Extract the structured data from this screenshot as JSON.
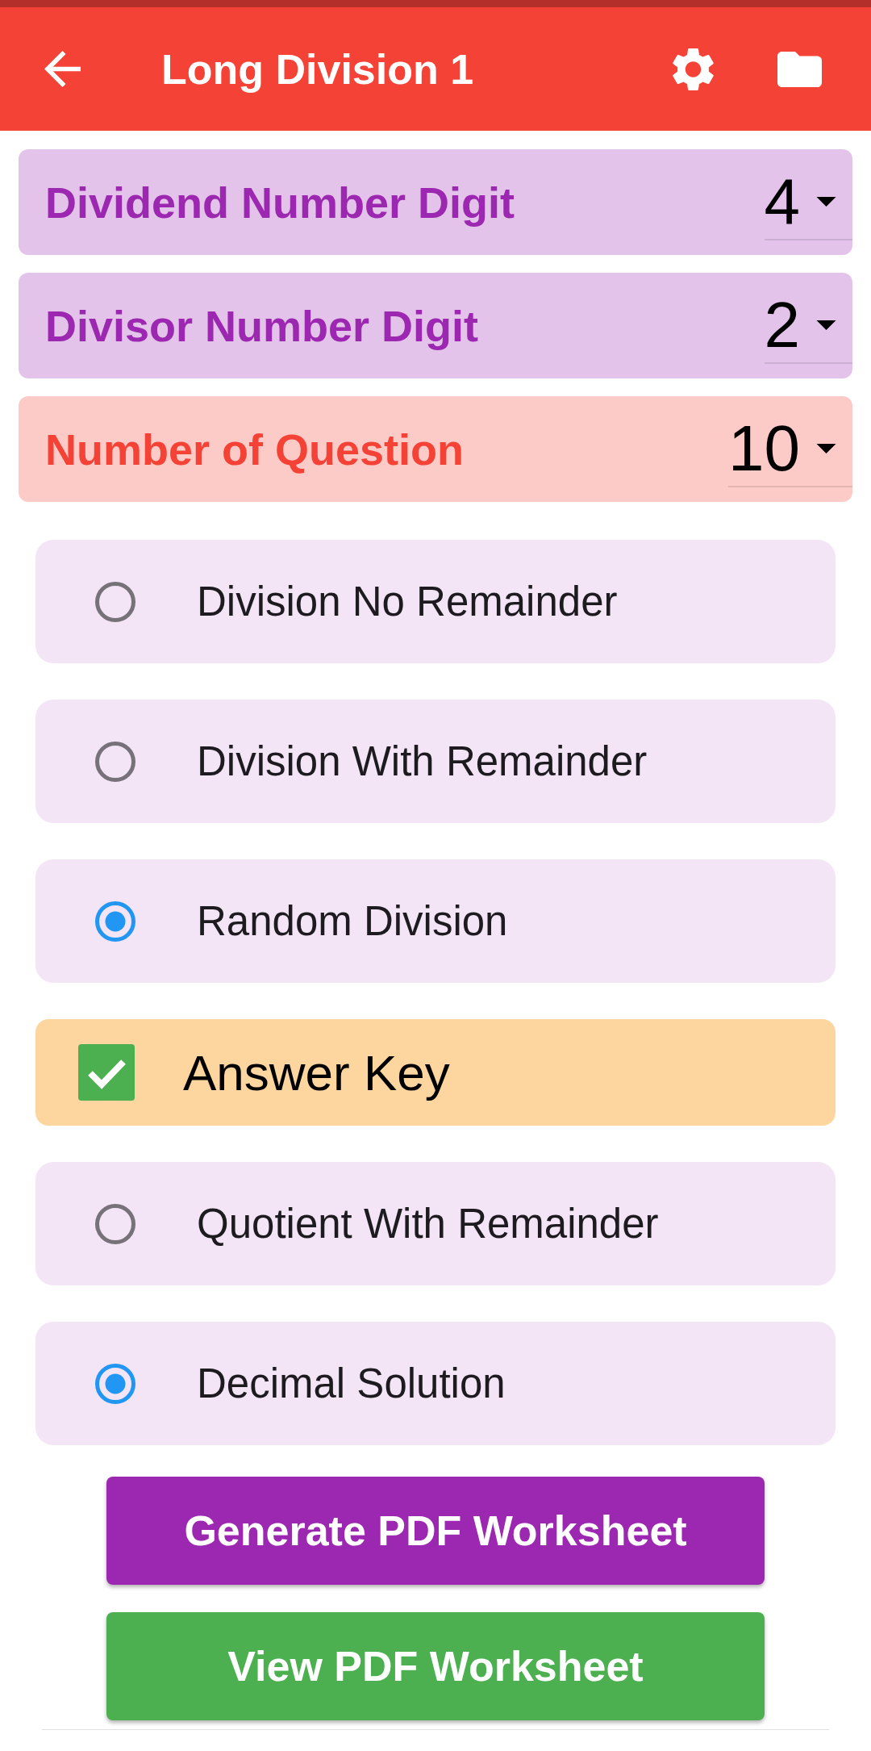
{
  "app_bar": {
    "title": "Long Division 1"
  },
  "settings": [
    {
      "label": "Dividend Number Digit",
      "value": "4",
      "color": "#9c27b0"
    },
    {
      "label": "Divisor Number Digit",
      "value": "2",
      "color": "#9c27b0"
    },
    {
      "label": "Number of Question",
      "value": "10",
      "color": "#f44336"
    }
  ],
  "division_type": [
    {
      "label": "Division No Remainder",
      "selected": false
    },
    {
      "label": "Division With Remainder",
      "selected": false
    },
    {
      "label": "Random Division",
      "selected": true
    }
  ],
  "answer_key": {
    "label": "Answer Key",
    "checked": true
  },
  "answer_format": [
    {
      "label": "Quotient With Remainder",
      "selected": false
    },
    {
      "label": "Decimal Solution",
      "selected": true
    }
  ],
  "buttons": [
    {
      "label": "Generate PDF Worksheet",
      "color": "#9c27b0"
    },
    {
      "label": "View PDF Worksheet",
      "color": "#4caf50"
    }
  ]
}
